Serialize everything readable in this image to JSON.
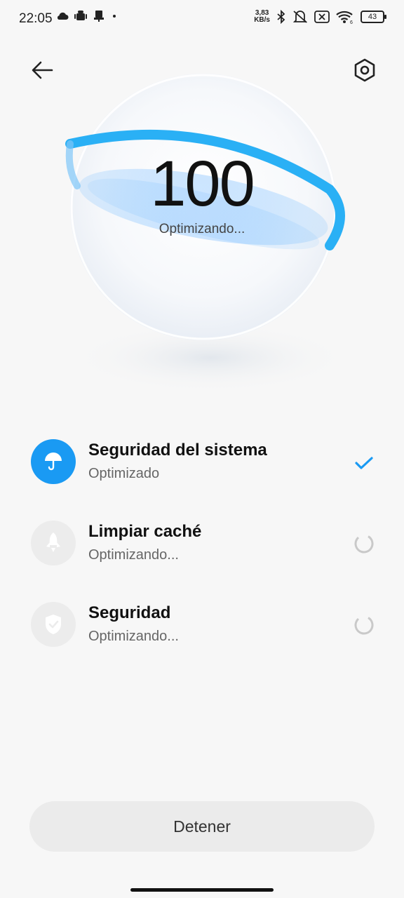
{
  "status_bar": {
    "time": "22:05",
    "net_speed_value": "3,83",
    "net_speed_unit": "KB/s",
    "battery": "43",
    "icons": [
      "cloud-icon",
      "android-icon",
      "usb-icon",
      "dot-icon",
      "bluetooth-icon",
      "vibrate-off-icon",
      "sim-off-icon",
      "wifi-icon",
      "battery-icon"
    ]
  },
  "header": {
    "back_icon": "arrow-left-icon",
    "settings_icon": "gear-icon"
  },
  "hero": {
    "score": "100",
    "status": "Optimizando..."
  },
  "items": [
    {
      "title": "Seguridad del sistema",
      "subtitle": "Optimizado",
      "icon": "umbrella-icon",
      "state": "done"
    },
    {
      "title": "Limpiar caché",
      "subtitle": "Optimizando...",
      "icon": "rocket-icon",
      "state": "loading"
    },
    {
      "title": "Seguridad",
      "subtitle": "Optimizando...",
      "icon": "shield-check-icon",
      "state": "loading"
    }
  ],
  "actions": {
    "stop_label": "Detener"
  },
  "colors": {
    "accent": "#1a9af3",
    "ring": "#2ab0f5",
    "background": "#f7f7f7"
  }
}
